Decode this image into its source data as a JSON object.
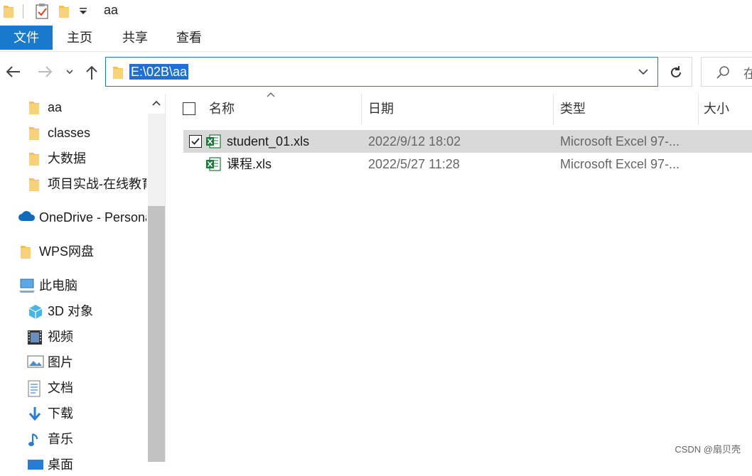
{
  "window": {
    "title": "aa"
  },
  "ribbon": {
    "tabs": [
      {
        "label": "文件",
        "active": true
      },
      {
        "label": "主页"
      },
      {
        "label": "共享"
      },
      {
        "label": "查看"
      }
    ]
  },
  "address": {
    "path": "E:\\02B\\aa",
    "search_placeholder": "在"
  },
  "sidebar": {
    "items": [
      {
        "label": "aa",
        "icon": "folder-icon"
      },
      {
        "label": "classes",
        "icon": "folder-icon"
      },
      {
        "label": "大数据",
        "icon": "folder-icon"
      },
      {
        "label": "项目实战-在线教育",
        "icon": "folder-icon"
      },
      {
        "label": "OneDrive - Personal",
        "icon": "onedrive-icon"
      },
      {
        "label": "WPS网盘",
        "icon": "folder-icon"
      },
      {
        "label": "此电脑",
        "icon": "computer-icon"
      },
      {
        "label": "3D 对象",
        "icon": "3d-objects-icon"
      },
      {
        "label": "视频",
        "icon": "video-icon"
      },
      {
        "label": "图片",
        "icon": "pictures-icon"
      },
      {
        "label": "文档",
        "icon": "documents-icon"
      },
      {
        "label": "下载",
        "icon": "download-icon"
      },
      {
        "label": "音乐",
        "icon": "music-icon"
      },
      {
        "label": "桌面",
        "icon": "desktop-icon"
      }
    ]
  },
  "columns": {
    "name": "名称",
    "date": "日期",
    "type": "类型",
    "size": "大小"
  },
  "files": [
    {
      "name": "student_01.xls",
      "date": "2022/9/12 18:02",
      "type": "Microsoft Excel 97-...",
      "selected": true
    },
    {
      "name": "课程.xls",
      "date": "2022/5/27 11:28",
      "type": "Microsoft Excel 97-...",
      "selected": false
    }
  ],
  "watermark": "CSDN @扇贝壳",
  "colors": {
    "accent": "#1979ca",
    "selection": "#d9d9d9",
    "folder": "#f2c14e",
    "excel": "#1d7a3e"
  }
}
